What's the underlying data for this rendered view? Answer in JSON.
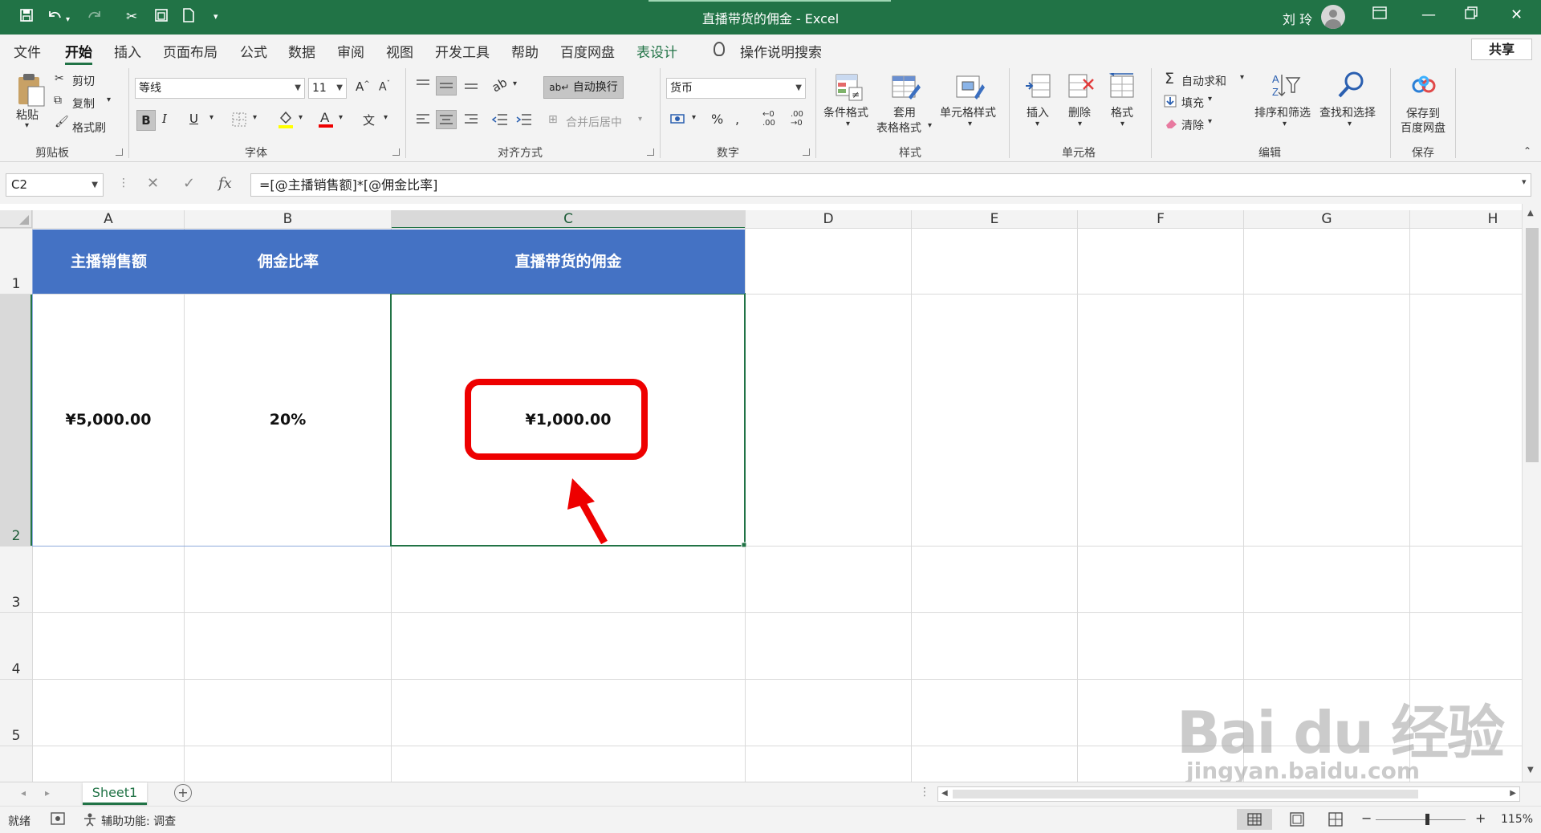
{
  "titlebar": {
    "title": "直播带货的佣金  -  Excel",
    "user": "刘 玲",
    "undo_icon": "undo-icon",
    "redo_icon": "redo-icon"
  },
  "menu": {
    "tabs": [
      "文件",
      "开始",
      "插入",
      "页面布局",
      "公式",
      "数据",
      "审阅",
      "视图",
      "开发工具",
      "帮助",
      "百度网盘",
      "表设计"
    ],
    "active": "开始",
    "search": "操作说明搜索",
    "share": "共享"
  },
  "ribbon": {
    "clipboard": {
      "paste": "粘贴",
      "cut": "剪切",
      "copy": "复制",
      "format_painter": "格式刷",
      "group": "剪贴板"
    },
    "font": {
      "name": "等线",
      "size": "11",
      "group": "字体",
      "bold": "B",
      "italic": "I",
      "underline": "U"
    },
    "alignment": {
      "wrap": "自动换行",
      "merge": "合并后居中",
      "group": "对齐方式"
    },
    "number": {
      "format": "货币",
      "percent": "%",
      "group": "数字"
    },
    "styles": {
      "conditional": "条件格式",
      "table_format_1": "套用",
      "table_format_2": "表格格式",
      "cell_styles": "单元格样式",
      "group": "样式"
    },
    "cells": {
      "insert": "插入",
      "delete": "删除",
      "format": "格式",
      "group": "单元格"
    },
    "editing": {
      "autosum": "自动求和",
      "fill": "填充",
      "clear": "清除",
      "sort": "排序和筛选",
      "find": "查找和选择",
      "group": "编辑"
    },
    "save": {
      "label1": "保存到",
      "label2": "百度网盘",
      "group": "保存"
    }
  },
  "formula_bar": {
    "name_box": "C2",
    "fx": "fx",
    "formula": "=[@主播销售额]*[@佣金比率]"
  },
  "sheet": {
    "columns": [
      "A",
      "B",
      "C",
      "D",
      "E",
      "F",
      "G",
      "H"
    ],
    "rows": [
      "1",
      "2",
      "3",
      "4",
      "5"
    ],
    "headers": [
      "主播销售额",
      "佣金比率",
      "直播带货的佣金"
    ],
    "values": [
      "¥5,000.00",
      "20%",
      "¥1,000.00"
    ]
  },
  "sheet_tabs": {
    "active": "Sheet1"
  },
  "status": {
    "ready": "就绪",
    "accessibility": "辅助功能: 调查",
    "zoom": "115%"
  },
  "watermark": {
    "logo": "Bai du 经验",
    "url": "jingyan.baidu.com"
  },
  "colors": {
    "excel_green": "#217346",
    "table_header": "#4472c4",
    "highlight": "#ee0000"
  }
}
